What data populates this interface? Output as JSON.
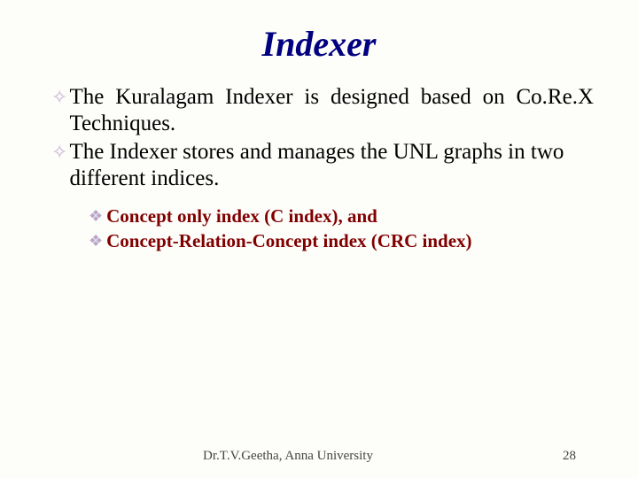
{
  "title": "Indexer",
  "bullets": [
    "The Kuralagam Indexer is designed based on Co.Re.X Techniques.",
    "The Indexer stores and manages the UNL graphs in two different indices."
  ],
  "subbullets": [
    "Concept only index (C index), and",
    "Concept-Relation-Concept index (CRC index)"
  ],
  "footer": {
    "author": "Dr.T.V.Geetha, Anna University",
    "page": "28"
  }
}
